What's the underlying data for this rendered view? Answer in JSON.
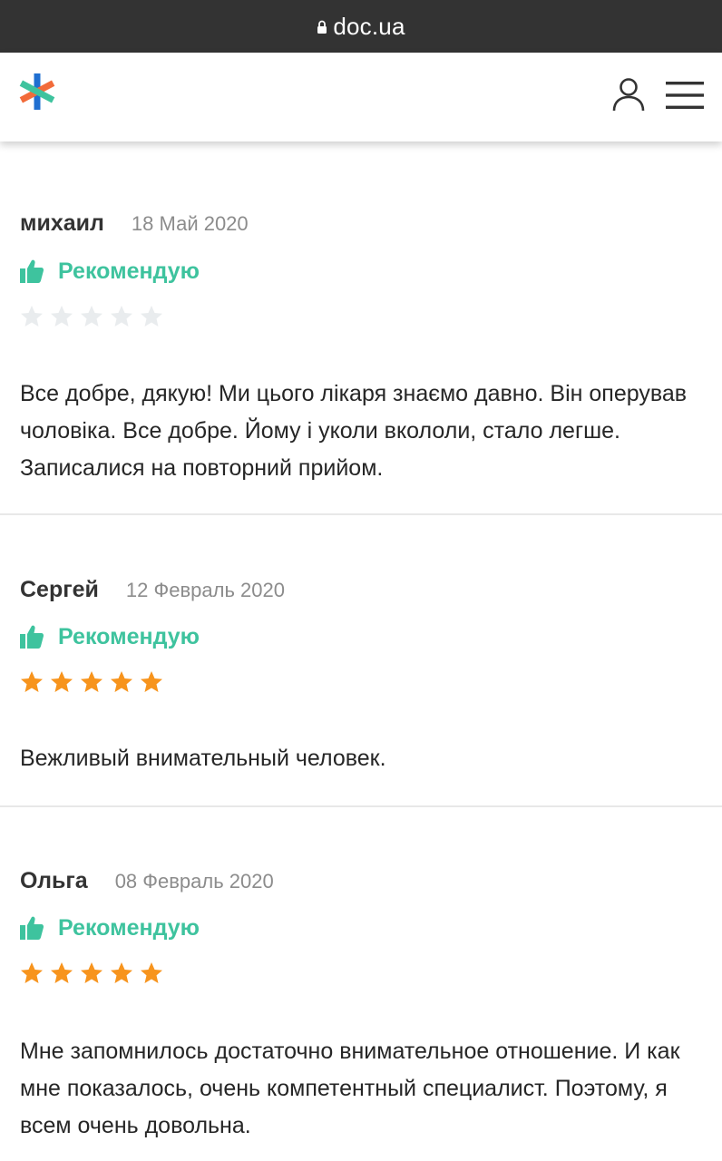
{
  "browser": {
    "url": "doc.ua",
    "lock_icon": "lock-icon"
  },
  "header": {
    "logo_icon": "asterisk-logo-icon",
    "user_icon": "user-icon",
    "menu_icon": "hamburger-menu-icon"
  },
  "colors": {
    "url_bar": "#333333",
    "recommend_green": "#3ec39e",
    "star_filled": "#f7941d",
    "star_empty": "#e9ecee",
    "logo_orange": "#f26b3a",
    "logo_green": "#3ec39e",
    "logo_blue": "#1f6fd1"
  },
  "reviews": [
    {
      "author": "михаил",
      "date": "18 Май 2020",
      "recommend_label": "Рекомендую",
      "rating": 0,
      "max_rating": 5,
      "text": "Все добре, дякую! Ми цього лікаря знаємо давно. Він оперував чоловіка. Все добре. Йому і уколи вкололи, стало легше. Записалися на повторний прийом."
    },
    {
      "author": "Сергей",
      "date": "12 Февраль 2020",
      "recommend_label": "Рекомендую",
      "rating": 5,
      "max_rating": 5,
      "text": "Вежливый внимательный человек."
    },
    {
      "author": "Ольга",
      "date": "08 Февраль 2020",
      "recommend_label": "Рекомендую",
      "rating": 5,
      "max_rating": 5,
      "text": "Мне запомнилось достаточно внимательное отношение. И как мне показалось, очень компетентный специалист. Поэтому, я всем очень довольна."
    }
  ]
}
